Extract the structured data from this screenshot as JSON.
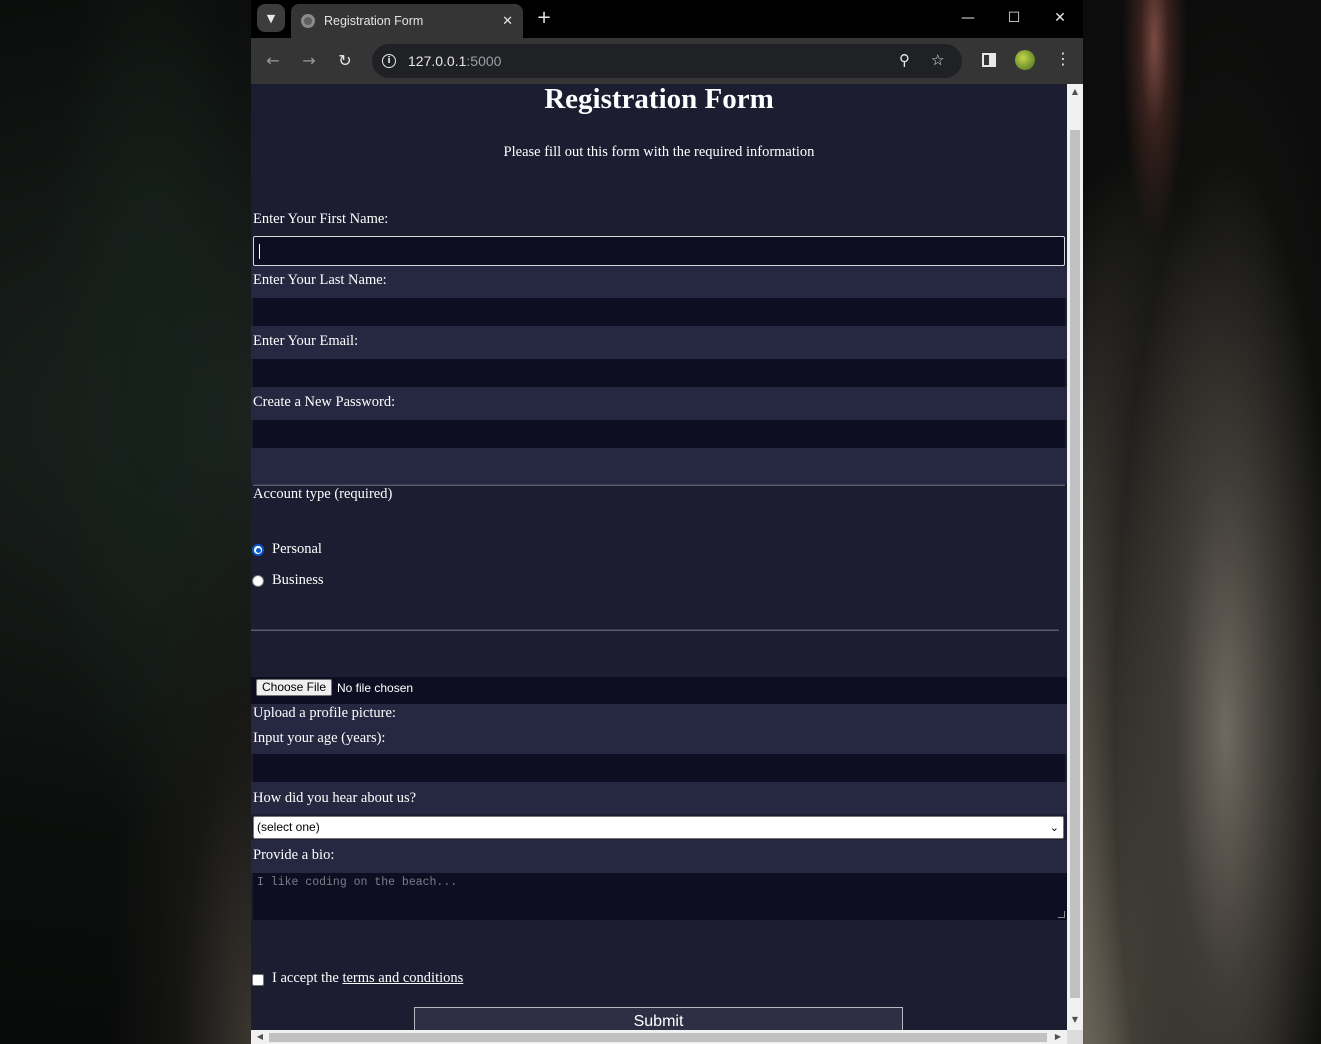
{
  "browser": {
    "tab_title": "Registration Form",
    "tab_close": "✕",
    "new_tab": "+",
    "url_host": "127.0.0.1",
    "url_port": ":5000",
    "window_controls": {
      "minimize": "—",
      "maximize": "☐",
      "close": "✕"
    },
    "icons": [
      "tab-search-icon",
      "favicon-icon",
      "back-icon",
      "forward-icon",
      "reload-icon",
      "info-icon",
      "zoom-icon",
      "star-icon",
      "side-panel-icon",
      "profile-avatar",
      "menu-icon"
    ]
  },
  "page": {
    "title": "Registration Form",
    "subtitle": "Please fill out this form with the required information",
    "first_name_label": "Enter Your First Name:",
    "last_name_label": "Enter Your Last Name:",
    "email_label": "Enter Your Email:",
    "password_label": "Create a New Password:",
    "account_type_label": "Account type (required)",
    "account_options": [
      "Personal",
      "Business"
    ],
    "account_selected": "Personal",
    "file_button": "Choose File",
    "file_status": "No file chosen",
    "profile_picture_label": "Upload a profile picture:",
    "age_label": "Input your age (years):",
    "referral_label": "How did you hear about us?",
    "referral_selected": "(select one)",
    "bio_label": "Provide a bio:",
    "bio_placeholder": "I like coding on the beach...",
    "terms_prefix": "I accept the ",
    "terms_link": "terms and conditions",
    "terms_checked": false,
    "submit_label": "Submit"
  },
  "colors": {
    "page_background": "#1c1d31",
    "input_background": "#0d0e22",
    "radio_accent": "#0b57d0"
  }
}
